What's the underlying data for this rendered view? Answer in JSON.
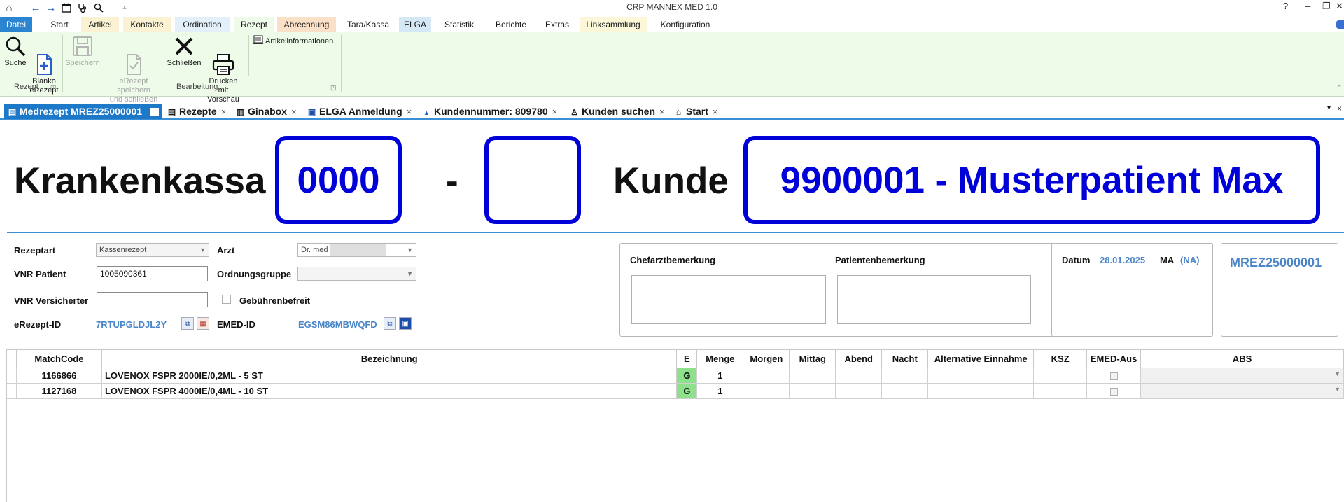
{
  "app": {
    "title": "CRP MANNEX MED 1.0",
    "help": "?",
    "window_controls": {
      "minimize": "–",
      "restore": "❐",
      "close": "✕"
    }
  },
  "quick_access": [
    "home-icon",
    "back-arrow-icon",
    "forward-arrow-icon",
    "calendar-icon",
    "stethoscope-icon",
    "search-icon",
    "customize-icon"
  ],
  "menu": {
    "items": [
      {
        "label": "Datei",
        "color": "#2b84d0"
      },
      {
        "label": "Start",
        "color": "#ffffff"
      },
      {
        "label": "Artikel",
        "color": "#fbf2d3"
      },
      {
        "label": "Kontakte",
        "color": "#fbf2d3"
      },
      {
        "label": "Ordination",
        "color": "#e3f0fa"
      },
      {
        "label": "Rezept",
        "color": "#eefbe9"
      },
      {
        "label": "Abrechnung",
        "color": "#fbe0c8"
      },
      {
        "label": "Tara/Kassa",
        "color": "#ffffff"
      },
      {
        "label": "ELGA",
        "color": "#d4e8f6"
      },
      {
        "label": "Statistik",
        "color": "#ffffff"
      },
      {
        "label": "Berichte",
        "color": "#ffffff"
      },
      {
        "label": "Extras",
        "color": "#ffffff"
      },
      {
        "label": "Linksammlung",
        "color": "#fbf7d8"
      },
      {
        "label": "Konfiguration",
        "color": "#ffffff"
      }
    ]
  },
  "ribbon": {
    "buttons": {
      "suche": "Suche",
      "blanko": "Blanko\neRezept",
      "speichern": "Speichern",
      "erezept_speichern": "eRezept speichern\nund schließen",
      "schliessen": "Schließen",
      "drucken": "Drucken mit\nVorschau",
      "artikelinfo": "Artikelinformationen"
    },
    "groups": {
      "rezept": "Rezept",
      "bearbeitung": "Bearbeitung"
    }
  },
  "tabs": [
    {
      "label": "Medrezept MREZ25000001",
      "icon": "prescription-icon"
    },
    {
      "label": "Rezepte",
      "icon": "prescription-icon"
    },
    {
      "label": "Ginabox",
      "icon": "chart-icon"
    },
    {
      "label": "ELGA Anmeldung",
      "icon": "elga-icon"
    },
    {
      "label": "Kundennummer: 809780",
      "icon": "user-icon"
    },
    {
      "label": "Kunden suchen",
      "icon": "user-search-icon"
    },
    {
      "label": "Start",
      "icon": "home-icon"
    }
  ],
  "header": {
    "krankenkassa_label": "Krankenkassa",
    "krankenkassa_value": "0000",
    "dash": "-",
    "second_value": "",
    "kunde_label": "Kunde",
    "kunde_value": "9900001 - Musterpatient Max",
    "accent": "#0000d8"
  },
  "form": {
    "rezeptart_label": "Rezeptart",
    "rezeptart_value": "Kassenrezept",
    "arzt_label": "Arzt",
    "arzt_value": "Dr. med",
    "vnr_patient_label": "VNR Patient",
    "vnr_patient_value": "1005090361",
    "ordnungsgruppe_label": "Ordnungsgruppe",
    "ordnungsgruppe_value": "",
    "vnr_versicherter_label": "VNR Versicherter",
    "vnr_versicherter_value": "",
    "gebuehrenbefreit_label": "Gebührenbefreit",
    "erezept_label": "eRezept-ID",
    "erezept_value": "7RTUPGLDJL2Y",
    "emed_label": "EMED-ID",
    "emed_value": "EGSM86MBWQFD"
  },
  "remarks": {
    "chefarzt_label": "Chefarztbemerkung",
    "patient_label": "Patientenbemerkung"
  },
  "info": {
    "datum_label": "Datum",
    "datum_value": "28.01.2025",
    "ma_label": "MA",
    "ma_value": "(NA)",
    "rezept_id": "MREZ25000001",
    "link_color": "#4a86c8"
  },
  "table": {
    "columns": [
      "MatchCode",
      "Bezeichnung",
      "E",
      "Menge",
      "Morgen",
      "Mittag",
      "Abend",
      "Nacht",
      "Alternative Einnahme",
      "KSZ",
      "EMED-Aus",
      "ABS"
    ],
    "rows": [
      {
        "matchcode": "1166866",
        "bezeichnung": "LOVENOX FSPR  2000IE/0,2ML - 5 ST",
        "e": "G",
        "menge": "1",
        "morgen": "",
        "mittag": "",
        "abend": "",
        "nacht": "",
        "alt": "",
        "ksz": "",
        "abs": ""
      },
      {
        "matchcode": "1127168",
        "bezeichnung": "LOVENOX FSPR  4000IE/0,4ML - 10 ST",
        "e": "G",
        "menge": "1",
        "morgen": "",
        "mittag": "",
        "abend": "",
        "nacht": "",
        "alt": "",
        "ksz": "",
        "abs": ""
      }
    ]
  }
}
